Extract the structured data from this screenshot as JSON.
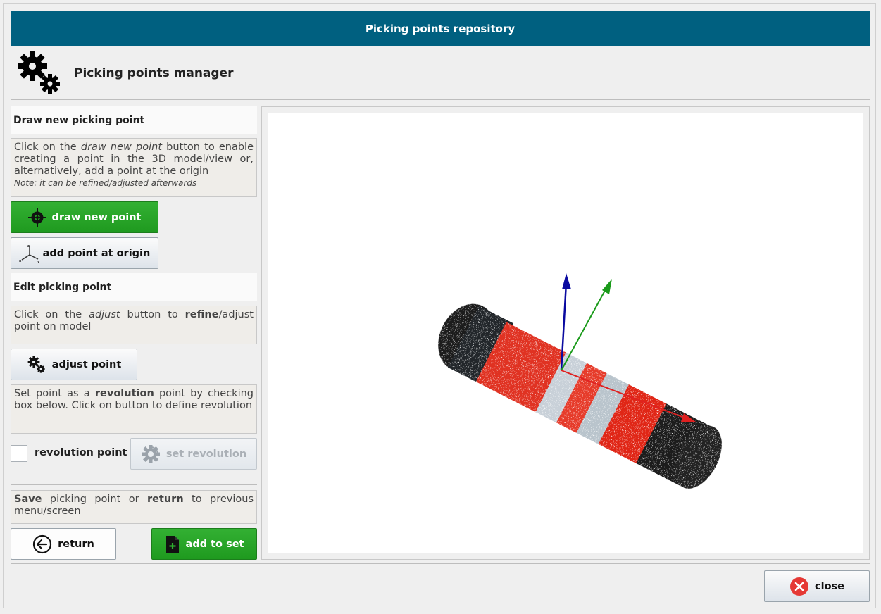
{
  "window": {
    "title": "Picking points repository"
  },
  "header": {
    "title": "Picking points manager",
    "icon": "gears-icon"
  },
  "draw_section": {
    "heading": "Draw new picking point",
    "info_pre": "Click on the ",
    "info_em": "draw new point",
    "info_post": " button to enable creating a point in the 3D model/view or, alternatively, add a point at the origin",
    "note": "Note: it can be refined/adjusted afterwards",
    "draw_button": "draw new point",
    "origin_button": "add point at origin"
  },
  "edit_section": {
    "heading": "Edit picking point",
    "info_pre": "Click on the ",
    "info_em": "adjust",
    "info_mid": " button to ",
    "info_strong": "refine",
    "info_post": "/adjust point on model",
    "adjust_button": "adjust point",
    "rev_info_pre": "Set point as a ",
    "rev_info_strong": "revolution",
    "rev_info_post": " point by checking box below. Click on button to define revolution",
    "revolution_checkbox_label": "revolution point",
    "revolution_checked": false,
    "set_revolution_button": "set revolution"
  },
  "footer_section": {
    "info_strong1": "Save",
    "info_mid": " picking point or ",
    "info_strong2": "return",
    "info_post": " to previous menu/screen",
    "return_button": "return",
    "add_button": "add to set"
  },
  "close_button": "close",
  "colors": {
    "title_bar": "#006080",
    "green_button": "#26a426",
    "axis_x": "#e02020",
    "axis_y": "#1a9a1a",
    "axis_z": "#0a0aa0",
    "close_icon": "#e53935"
  }
}
